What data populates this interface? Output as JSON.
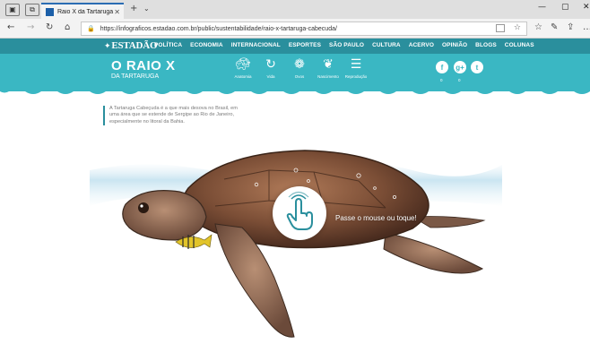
{
  "browser": {
    "tab_title": "Raio X da Tartaruga Cab",
    "url": "https://infograficos.estadao.com.br/public/sustentabilidade/raio-x-tartaruga-cabecuda/",
    "icons": [
      "back-icon",
      "forward-icon",
      "refresh-icon",
      "home-icon",
      "lock-icon",
      "favorites-star-icon",
      "reading-list-icon",
      "pen-icon",
      "share-icon",
      "more-icon"
    ]
  },
  "sitenav": {
    "logo": "ESTADÃO",
    "links": [
      "POLÍTICA",
      "ECONOMIA",
      "INTERNACIONAL",
      "ESPORTES",
      "SÃO PAULO",
      "CULTURA",
      "ACERVO",
      "OPINIÃO",
      "BLOGS",
      "COLUNAS"
    ]
  },
  "hero": {
    "title_line1": "O RAIO X",
    "title_line2": "DA TARTARUGA",
    "menu": [
      {
        "label": "Anatomia",
        "icon": "turtle-icon"
      },
      {
        "label": "Vida",
        "icon": "cycle-icon"
      },
      {
        "label": "Ovos",
        "icon": "eggs-icon"
      },
      {
        "label": "Nascimento",
        "icon": "hatchling-icon"
      },
      {
        "label": "Reprodução",
        "icon": "list-icon"
      }
    ],
    "social": [
      {
        "icon": "facebook-icon",
        "glyph": "f",
        "count": "0"
      },
      {
        "icon": "google-plus-icon",
        "glyph": "g+",
        "count": "0"
      },
      {
        "icon": "twitter-icon",
        "glyph": "t",
        "count": ""
      }
    ],
    "colors": {
      "nav": "#2a8f9d",
      "banner": "#3ab7c3"
    }
  },
  "intro": {
    "text": "A Tartaruga Cabeçuda é a que mais desova no Brasil, em uma área que se estende de Sergipe ao Rio de Janeiro, especialmente no litoral da Bahia."
  },
  "scene": {
    "hint": "Passe o mouse ou toque!",
    "hand_icon": "tap-hand-icon"
  }
}
